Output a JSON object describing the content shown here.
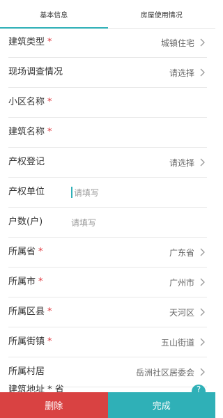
{
  "tabs": [
    {
      "label": "基本信息",
      "active": true
    },
    {
      "label": "房屋使用情况",
      "active": false
    }
  ],
  "form": {
    "rows": [
      {
        "label": "建筑类型",
        "required": true,
        "value": "城镇住宅",
        "chevron": true
      },
      {
        "label": "现场调查情况",
        "required": false,
        "value": "请选择",
        "chevron": true
      },
      {
        "label": "小区名称",
        "required": true,
        "value": "",
        "chevron": false
      },
      {
        "label": "建筑名称",
        "required": true,
        "value": "",
        "chevron": false
      },
      {
        "label": "产权登记",
        "required": false,
        "value": "请选择",
        "chevron": true
      },
      {
        "label": "产权单位",
        "required": false,
        "placeholder": "请填写",
        "cursor": true
      },
      {
        "label": "户数(户)",
        "required": false,
        "placeholder": "请填写"
      },
      {
        "label": "所属省",
        "required": true,
        "value": "广东省",
        "chevron": true
      },
      {
        "label": "所属市",
        "required": true,
        "value": "广州市",
        "chevron": true
      },
      {
        "label": "所属区县",
        "required": true,
        "value": "天河区",
        "chevron": true
      },
      {
        "label": "所属街镇",
        "required": true,
        "value": "五山街道",
        "chevron": true
      },
      {
        "label": "所属村居",
        "required": false,
        "value": "岳洲社区居委会",
        "chevron": true
      }
    ],
    "partial_row": {
      "label": "建筑地址 * 省"
    }
  },
  "bottom": {
    "delete_label": "删除",
    "done_label": "完成"
  },
  "colors": {
    "accent": "#2fb0b7",
    "danger": "#d94242",
    "required": "#e0353c"
  }
}
